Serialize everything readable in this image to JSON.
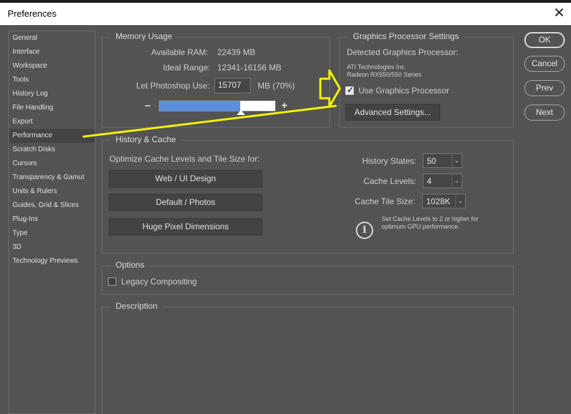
{
  "window": {
    "title": "Preferences",
    "close_symbol": "✕"
  },
  "sidebar": {
    "items": [
      {
        "label": "General"
      },
      {
        "label": "Interface"
      },
      {
        "label": "Workspace"
      },
      {
        "label": "Tools"
      },
      {
        "label": "History Log"
      },
      {
        "label": "File Handling"
      },
      {
        "label": "Export"
      },
      {
        "label": "Performance",
        "selected": true
      },
      {
        "label": "Scratch Disks"
      },
      {
        "label": "Cursors"
      },
      {
        "label": "Transparency & Gamut"
      },
      {
        "label": "Units & Rulers"
      },
      {
        "label": "Guides, Grid & Slices"
      },
      {
        "label": "Plug-Ins"
      },
      {
        "label": "Type"
      },
      {
        "label": "3D"
      },
      {
        "label": "Technology Previews"
      }
    ]
  },
  "memory": {
    "legend": "Memory Usage",
    "available_label": "Available RAM:",
    "available_value": "22439 MB",
    "ideal_label": "Ideal Range:",
    "ideal_value": "12341-16156 MB",
    "let_label": "Let Photoshop Use:",
    "let_value": "15707",
    "let_unit": "MB (70%)",
    "slider_fraction": 0.7,
    "minus": "–",
    "plus": "+"
  },
  "gpu": {
    "legend": "Graphics Processor Settings",
    "detected_label": "Detected Graphics Processor:",
    "vendor": "ATI Technologies Inc.",
    "model": "Radeon RX550/550 Series",
    "use_label": "Use Graphics Processor",
    "use_checked": true,
    "advanced_button": "Advanced Settings..."
  },
  "cache": {
    "legend": "History & Cache",
    "optimize_label": "Optimize Cache Levels and Tile Size for:",
    "buttons": [
      "Web / UI Design",
      "Default / Photos",
      "Huge Pixel Dimensions"
    ],
    "history_states_label": "History States:",
    "history_states_value": "50",
    "cache_levels_label": "Cache Levels:",
    "cache_levels_value": "4",
    "tile_size_label": "Cache Tile Size:",
    "tile_size_value": "1028K",
    "info_icon": "i",
    "note_line1": "Set Cache Levels to 2 or higher for",
    "note_line2": "optimum GPU performance."
  },
  "options": {
    "legend": "Options",
    "legacy_label": "Legacy Compositing",
    "legacy_checked": false
  },
  "description": {
    "legend": "Description"
  },
  "buttons": {
    "ok": "OK",
    "cancel": "Cancel",
    "prev": "Prev",
    "next": "Next"
  },
  "annotation": {
    "color": "#f5f500"
  }
}
